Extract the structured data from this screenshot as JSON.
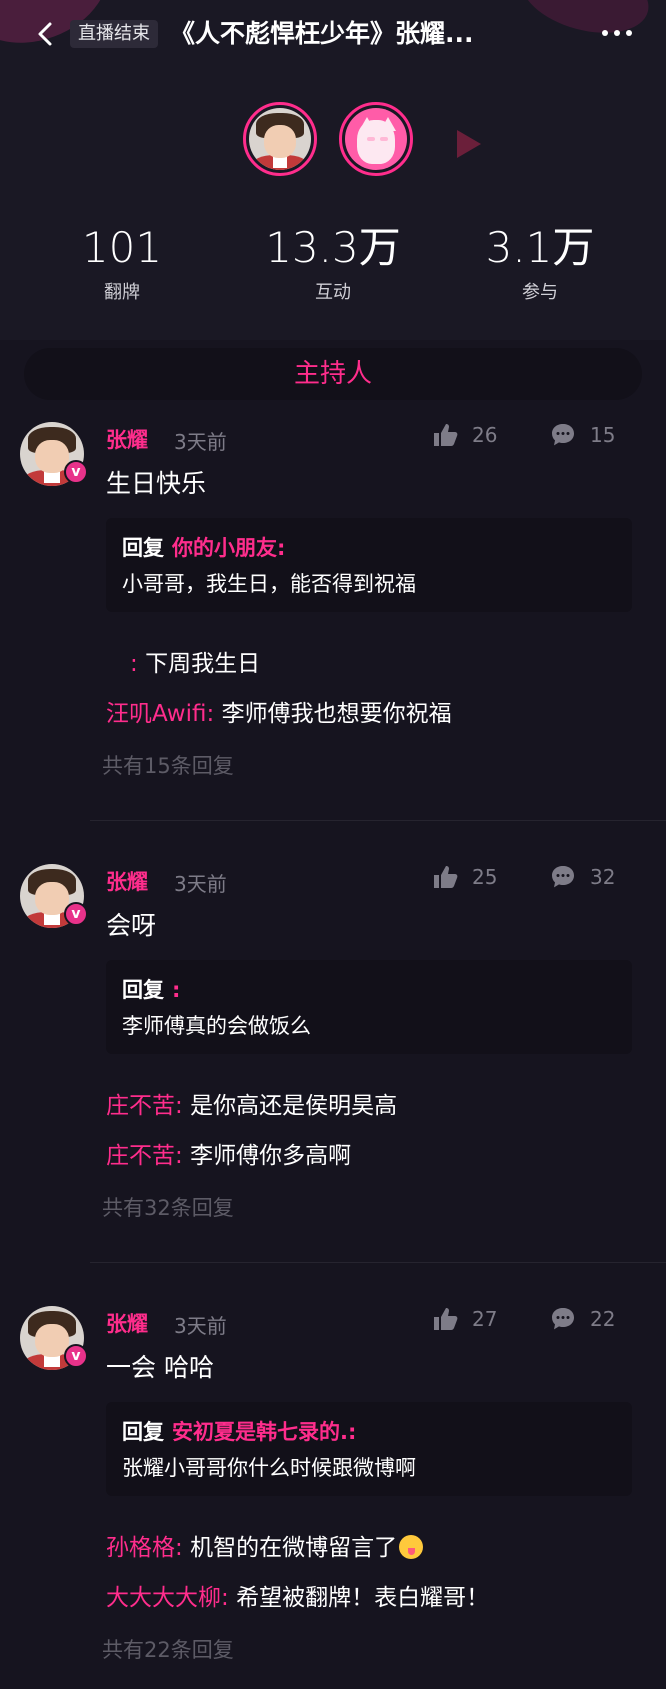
{
  "header": {
    "status_tag": "直播结束",
    "title": "《人不彪悍枉少年》张耀..."
  },
  "stats": [
    {
      "value": "101",
      "label": "翻牌"
    },
    {
      "value": "13.3万",
      "label": "互动"
    },
    {
      "value": "3.1万",
      "label": "参与"
    }
  ],
  "host_section": {
    "label": "主持人"
  },
  "comments": [
    {
      "author": "张耀",
      "verified_badge": "v",
      "time": "3天前",
      "likes": "26",
      "replies": "15",
      "text": "生日快乐",
      "quote": {
        "prefix": "回复",
        "name": "你的小朋友:",
        "text": "小哥哥，我生日，能否得到祝福"
      },
      "reply_lines": [
        {
          "name": ":",
          "text": "下周我生日"
        },
        {
          "name": "汪叽Awifi:",
          "text": "李师傅我也想要你祝福"
        }
      ],
      "total": "共有15条回复"
    },
    {
      "author": "张耀",
      "verified_badge": "v",
      "time": "3天前",
      "likes": "25",
      "replies": "32",
      "text": "会呀",
      "quote": {
        "prefix": "回复",
        "name": ":",
        "text": "李师傅真的会做饭么"
      },
      "reply_lines": [
        {
          "name": "庄不苦:",
          "text": "是你高还是侯明昊高"
        },
        {
          "name": "庄不苦:",
          "text": "李师傅你多高啊"
        }
      ],
      "total": "共有32条回复"
    },
    {
      "author": "张耀",
      "verified_badge": "v",
      "time": "3天前",
      "likes": "27",
      "replies": "22",
      "text": "一会 哈哈",
      "quote": {
        "prefix": "回复",
        "name": "安初夏是韩七录的.:",
        "text": "张耀小哥哥你什么时候跟微博啊"
      },
      "reply_lines": [
        {
          "name": "孙格格:",
          "text": "机智的在微博留言了"
        },
        {
          "name": "大大大大柳:",
          "text": "希望被翻牌！表白耀哥！"
        }
      ],
      "total": "共有22条回复"
    }
  ],
  "colors": {
    "background": "#16141f",
    "accent": "#ff2d8c",
    "muted": "#7e7c88"
  }
}
